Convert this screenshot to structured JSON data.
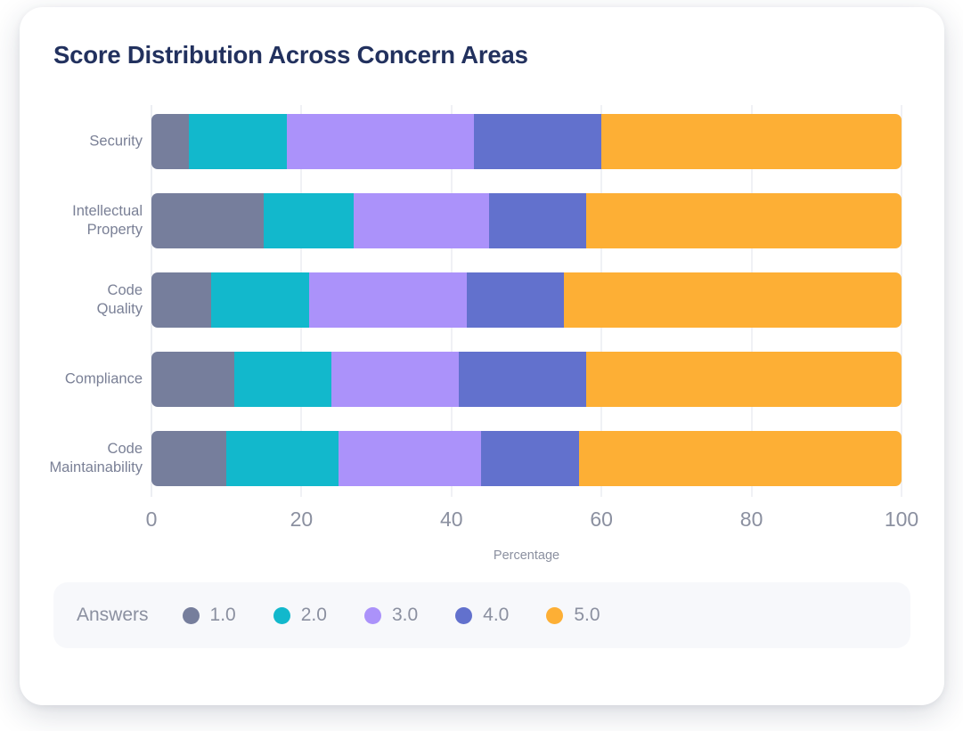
{
  "card": {
    "title": "Score Distribution Across Concern Areas"
  },
  "legend": {
    "title": "Answers",
    "items": [
      {
        "label": "1.0",
        "color": "#767e9c"
      },
      {
        "label": "2.0",
        "color": "#12b8cc"
      },
      {
        "label": "3.0",
        "color": "#ab92fa"
      },
      {
        "label": "4.0",
        "color": "#6271cd"
      },
      {
        "label": "5.0",
        "color": "#fdaf35"
      }
    ]
  },
  "chart_data": {
    "type": "bar",
    "orientation": "horizontal",
    "stacked": true,
    "stack_mode": "percent",
    "title": "Score Distribution Across Concern Areas",
    "xlabel": "Percentage",
    "ylabel": "",
    "xlim": [
      0,
      100
    ],
    "xticks": [
      "0",
      "20",
      "40",
      "60",
      "80",
      "100"
    ],
    "xtick_values": [
      0,
      20,
      40,
      60,
      80,
      100
    ],
    "grid": true,
    "legend_position": "bottom",
    "legend_title": "Answers",
    "categories": [
      "Security",
      "Intellectual\nProperty",
      "Code\nQuality",
      "Compliance",
      "Code\nMaintainability"
    ],
    "series": [
      {
        "name": "1.0",
        "color": "#767e9c",
        "values": [
          5,
          15,
          8,
          11,
          10
        ]
      },
      {
        "name": "2.0",
        "color": "#12b8cc",
        "values": [
          13,
          12,
          13,
          13,
          15
        ]
      },
      {
        "name": "3.0",
        "color": "#ab92fa",
        "values": [
          25,
          18,
          21,
          17,
          19
        ]
      },
      {
        "name": "4.0",
        "color": "#6271cd",
        "values": [
          17,
          13,
          13,
          17,
          13
        ]
      },
      {
        "name": "5.0",
        "color": "#fdaf35",
        "values": [
          40,
          42,
          45,
          42,
          43
        ]
      }
    ]
  }
}
